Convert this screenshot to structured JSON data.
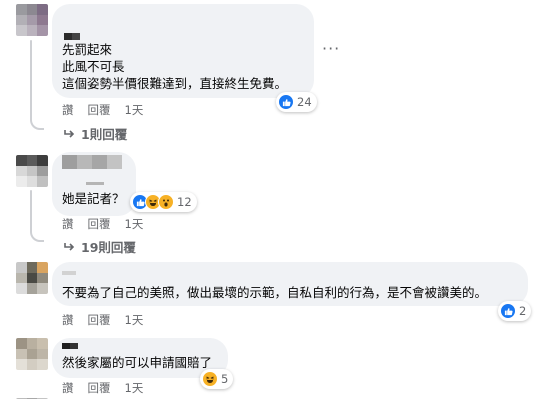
{
  "comments": [
    {
      "lines": [
        "先罰起來",
        "此風不可長",
        "這個姿勢半價很難達到，直接終生免費。"
      ],
      "actions": {
        "like": "讚",
        "reply": "回覆",
        "time": "1天"
      },
      "reactions": {
        "types": [
          "like"
        ],
        "count": "24"
      },
      "replies_label": "1則回覆",
      "more_icon": "more-horizontal-icon"
    },
    {
      "lines": [
        "她是記者？"
      ],
      "actions": {
        "like": "讚",
        "reply": "回覆",
        "time": "1天"
      },
      "reactions": {
        "types": [
          "like",
          "haha",
          "wow"
        ],
        "count": "12"
      },
      "replies_label": "19則回覆"
    },
    {
      "lines": [
        "不要為了自己的美照，做出最壞的示範，自私自利的行為，是不會被讚美的。"
      ],
      "actions": {
        "like": "讚",
        "reply": "回覆",
        "time": "1天"
      },
      "reactions": {
        "types": [
          "like"
        ],
        "count": "2"
      }
    },
    {
      "lines": [
        "然後家屬的可以申請國賠了"
      ],
      "actions": {
        "like": "讚",
        "reply": "回覆",
        "time": "1天"
      },
      "reactions": {
        "types": [
          "haha"
        ],
        "count": "5"
      }
    }
  ],
  "colors": {
    "bubble": "#f0f2f5",
    "secondary_text": "#65676b",
    "like_blue": "#1877f2",
    "haha_yellow": "#f7b125"
  }
}
